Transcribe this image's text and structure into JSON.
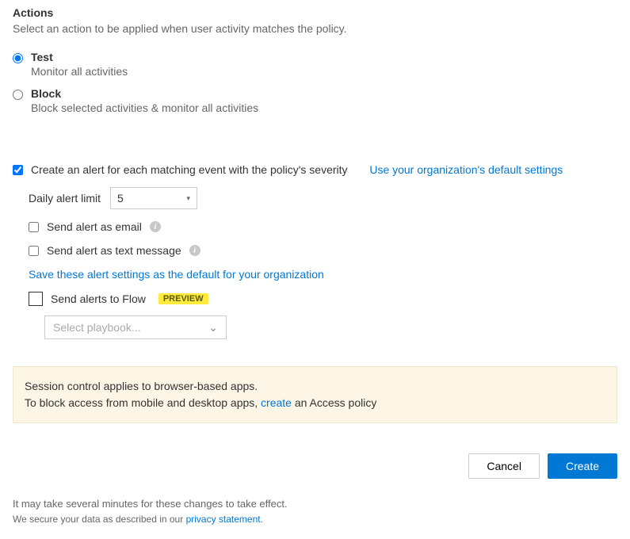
{
  "section": {
    "title": "Actions",
    "subtitle": "Select an action to be applied when user activity matches the policy."
  },
  "modes": {
    "test": {
      "label": "Test",
      "desc": "Monitor all activities"
    },
    "block": {
      "label": "Block",
      "desc": "Block selected activities & monitor all activities"
    }
  },
  "alert": {
    "create_label": "Create an alert for each matching event with the policy's severity",
    "default_link": "Use your organization's default settings",
    "daily_limit_label": "Daily alert limit",
    "daily_limit_value": "5",
    "email_label": "Send alert as email",
    "sms_label": "Send alert as text message",
    "save_default_link": "Save these alert settings as the default for your organization",
    "flow_label": "Send alerts to Flow",
    "preview_badge": "PREVIEW",
    "playbook_placeholder": "Select playbook..."
  },
  "banner": {
    "line1": "Session control applies to browser-based apps.",
    "line2a": "To block access from mobile and desktop apps, ",
    "line2link": "create",
    "line2b": " an Access policy"
  },
  "buttons": {
    "cancel": "Cancel",
    "create": "Create"
  },
  "footnote": {
    "line1": "It may take several minutes for these changes to take effect.",
    "line2a": "We secure your data as described in our ",
    "line2link": "privacy statement",
    "line2b": "."
  },
  "icons": {
    "info": "i",
    "caret": "▾",
    "chevron": "⌄"
  }
}
